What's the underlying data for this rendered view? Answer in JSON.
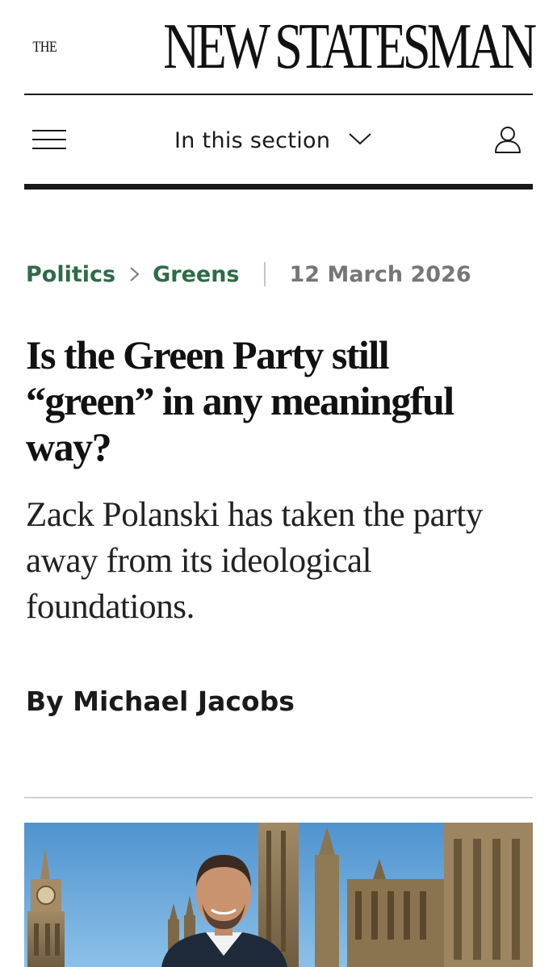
{
  "masthead": {
    "logo_prefix": "THE",
    "logo_name": "NEW STATESMAN"
  },
  "navbar": {
    "menu_icon": "hamburger-menu-icon",
    "section_label": "In this section",
    "section_icon": "chevron-down-icon",
    "account_icon": "user-account-icon"
  },
  "breadcrumb": {
    "items": [
      "Politics",
      "Greens"
    ],
    "separator_icon": "chevron-right-icon",
    "date": "12 March 2026"
  },
  "article": {
    "headline": "Is the Green Party still “green” in any meaningful way?",
    "standfirst": "Zack Polanski has taken the party away from its ideological foundations.",
    "byline_prefix": "By",
    "author": "Michael Jacobs"
  },
  "hero_image": {
    "description_icon": "article-photo"
  },
  "colors": {
    "accent_green": "#2e6b47",
    "text_dark": "#1a1a1a",
    "date_grey": "#767676",
    "divider_light": "#d2d2d2"
  }
}
